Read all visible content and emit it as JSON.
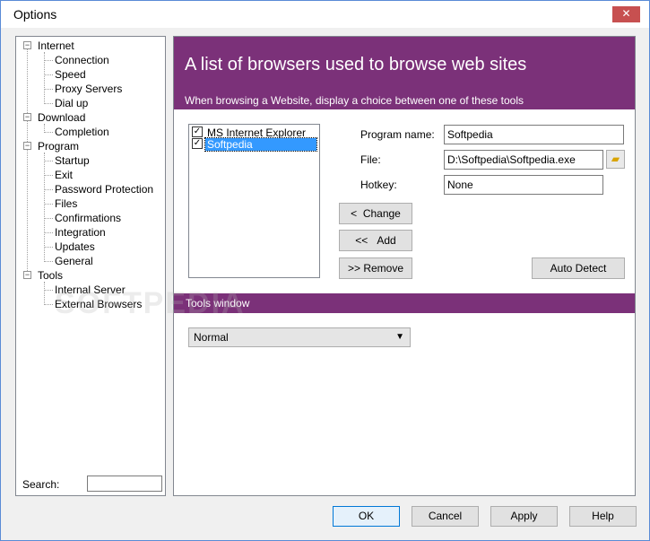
{
  "window": {
    "title": "Options",
    "close_glyph": "✕"
  },
  "tree": {
    "items": [
      {
        "label": "Internet",
        "level": 0,
        "toggle": "−"
      },
      {
        "label": "Connection",
        "level": 1
      },
      {
        "label": "Speed",
        "level": 1
      },
      {
        "label": "Proxy Servers",
        "level": 1
      },
      {
        "label": "Dial up",
        "level": 1
      },
      {
        "label": "Download",
        "level": 0,
        "toggle": "−"
      },
      {
        "label": "Completion",
        "level": 1
      },
      {
        "label": "Program",
        "level": 0,
        "toggle": "−"
      },
      {
        "label": "Startup",
        "level": 1
      },
      {
        "label": "Exit",
        "level": 1
      },
      {
        "label": "Password Protection",
        "level": 1
      },
      {
        "label": "Files",
        "level": 1
      },
      {
        "label": "Confirmations",
        "level": 1
      },
      {
        "label": "Integration",
        "level": 1
      },
      {
        "label": "Updates",
        "level": 1
      },
      {
        "label": "General",
        "level": 1
      },
      {
        "label": "Tools",
        "level": 0,
        "toggle": "−"
      },
      {
        "label": "Internal Server",
        "level": 1
      },
      {
        "label": "External Browsers",
        "level": 1
      }
    ],
    "search_label": "Search:",
    "search_value": ""
  },
  "main": {
    "header_title": "A list of browsers used to browse web sites",
    "header_subtitle": "When browsing a Website, display a choice between one of these tools",
    "browsers": [
      {
        "label": "MS Internet Explorer",
        "checked": true,
        "selected": false
      },
      {
        "label": "Softpedia",
        "checked": true,
        "selected": true
      }
    ],
    "program_name_label": "Program name:",
    "program_name_value": "Softpedia",
    "file_label": "File:",
    "file_value": "D:\\Softpedia\\Softpedia.exe",
    "hotkey_label": "Hotkey:",
    "hotkey_value": "None",
    "change_arrow": "<",
    "change_label": "Change",
    "add_arrow": "<<",
    "add_label": "Add",
    "remove_arrow": ">>",
    "remove_label": "Remove",
    "auto_detect_label": "Auto Detect",
    "tools_window_label": "Tools window",
    "tools_window_value": "Normal",
    "accent_color": "#7b3179"
  },
  "footer": {
    "ok_label": "OK",
    "cancel_label": "Cancel",
    "apply_label": "Apply",
    "help_label": "Help"
  },
  "watermark": "SOFTPEDIA"
}
